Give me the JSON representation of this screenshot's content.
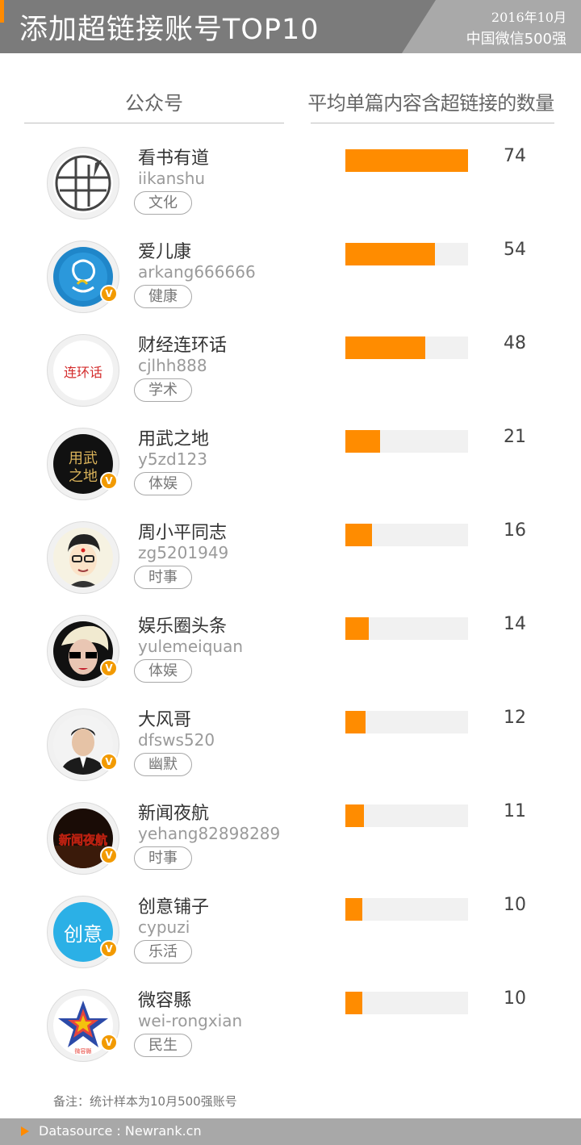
{
  "header": {
    "title": "添加超链接账号TOP10",
    "date": "2016年10月",
    "subtitle": "中国微信500强",
    "accent_color": "#ff8a00"
  },
  "columns": {
    "account": "公众号",
    "metric": "平均单篇内容含超链接的数量"
  },
  "chart_data": {
    "type": "bar",
    "ylabel": "平均单篇内容含超链接的数量",
    "ylim": [
      0,
      74
    ],
    "bar_color": "#ff8c00",
    "track_color": "#f1f1f1",
    "categories": [
      "看书有道",
      "爱儿康",
      "财经连环话",
      "用武之地",
      "周小平同志",
      "娱乐圈头条",
      "大风哥",
      "新闻夜航",
      "创意铺子",
      "微容縣"
    ],
    "values": [
      74,
      54,
      48,
      21,
      16,
      14,
      12,
      11,
      10,
      10
    ]
  },
  "accounts": [
    {
      "name": "看书有道",
      "handle": "iikanshu",
      "tag": "文化",
      "value": 74,
      "verified": false,
      "avatar_icon": "book-grid-icon"
    },
    {
      "name": "爱儿康",
      "handle": "arkang666666",
      "tag": "健康",
      "value": 54,
      "verified": true,
      "avatar_icon": "baby-outline-icon"
    },
    {
      "name": "财经连环话",
      "handle": "cjlhh888",
      "tag": "学术",
      "value": 48,
      "verified": false,
      "avatar_icon": "calligraphy-logo-icon",
      "avatar_text": "连环话"
    },
    {
      "name": "用武之地",
      "handle": "y5zd123",
      "tag": "体娱",
      "value": 21,
      "verified": true,
      "avatar_icon": "gold-calligraphy-icon",
      "avatar_text": "用武之地"
    },
    {
      "name": "周小平同志",
      "handle": "zg5201949",
      "tag": "时事",
      "value": 16,
      "verified": false,
      "avatar_icon": "cartoon-man-icon"
    },
    {
      "name": "娱乐圈头条",
      "handle": "yulemeiquan",
      "tag": "体娱",
      "value": 14,
      "verified": true,
      "avatar_icon": "sunglasses-woman-icon"
    },
    {
      "name": "大风哥",
      "handle": "dfsws520",
      "tag": "幽默",
      "value": 12,
      "verified": true,
      "avatar_icon": "man-portrait-icon"
    },
    {
      "name": "新闻夜航",
      "handle": "yehang82898289",
      "tag": "时事",
      "value": 11,
      "verified": true,
      "avatar_icon": "news-night-logo-icon",
      "avatar_text": "新闻夜航"
    },
    {
      "name": "创意铺子",
      "handle": "cypuzi",
      "tag": "乐活",
      "value": 10,
      "verified": true,
      "avatar_icon": "creative-script-icon",
      "avatar_text": "创意"
    },
    {
      "name": "微容縣",
      "handle": "wei-rongxian",
      "tag": "民生",
      "value": 10,
      "verified": true,
      "avatar_icon": "colorful-star-icon",
      "avatar_text": "微容縣"
    }
  ],
  "verified_badge": "V",
  "note": "备注：统计样本为10月500强账号",
  "footer": {
    "datasource": "Datasource : Newrank.cn"
  }
}
